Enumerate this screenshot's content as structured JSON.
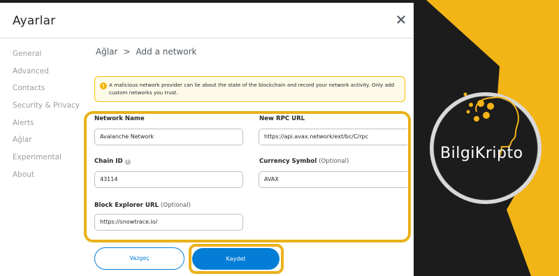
{
  "window": {
    "title": "Ayarlar"
  },
  "sidebar": {
    "items": [
      {
        "label": "General"
      },
      {
        "label": "Advanced"
      },
      {
        "label": "Contacts"
      },
      {
        "label": "Security & Privacy"
      },
      {
        "label": "Alerts"
      },
      {
        "label": "Ağlar"
      },
      {
        "label": "Experimental"
      },
      {
        "label": "About"
      }
    ]
  },
  "breadcrumb": {
    "root": "Ağlar",
    "separator": ">",
    "current": "Add a network"
  },
  "warning": {
    "text": "A malicious network provider can lie about the state of the blockchain and record your network activity. Only add custom networks you trust."
  },
  "form": {
    "network_name": {
      "label": "Network Name",
      "value": "Avalanche Network"
    },
    "rpc_url": {
      "label": "New RPC URL",
      "value": "https://api.avax.network/ext/bc/C/rpc"
    },
    "chain_id": {
      "label": "Chain ID",
      "value": "43114"
    },
    "currency_symbol": {
      "label": "Currency Symbol",
      "optional": "(Optional)",
      "value": "AVAX"
    },
    "block_explorer": {
      "label": "Block Explorer URL",
      "optional": "(Optional)",
      "value": "https://snowtrace.io/"
    }
  },
  "buttons": {
    "cancel": "Vazgeç",
    "save": "Kaydet"
  },
  "brand": {
    "name": "BilgiKripto"
  },
  "colors": {
    "accent": "#037dd6",
    "highlight": "#eab21a",
    "warning_border": "#f8c000",
    "brand_yellow": "#f3b416"
  },
  "icons": [
    "close-icon",
    "warning-icon",
    "info-icon",
    "brain-logo-icon"
  ]
}
